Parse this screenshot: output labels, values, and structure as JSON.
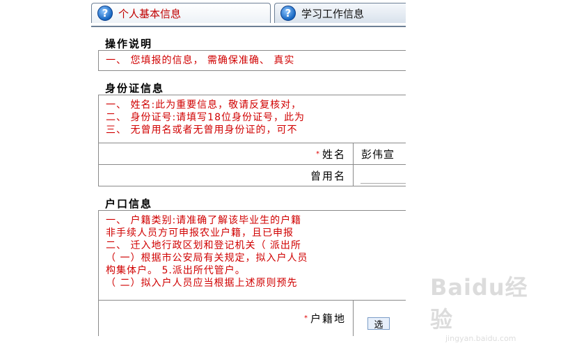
{
  "tabs": [
    {
      "label": "个人基本信息",
      "state": "active"
    },
    {
      "label": "学习工作信息",
      "state": "inactive"
    }
  ],
  "operation": {
    "title": "操作说明",
    "lines": [
      "一、 您填报的信息， 需确保准确、 真实"
    ]
  },
  "identity": {
    "title": "身份证信息",
    "lines": [
      "一、 姓名:此为重要信息，敬请反复核对，",
      "二、 身份证号:请填写18位身份证号，此为",
      "三、 无曾用名或者无曾用身份证的，可不"
    ],
    "required_mark": "*",
    "name_label": "姓名",
    "name_value": "彭伟宣",
    "former_name_label": "曾用名",
    "former_name_value": ""
  },
  "household": {
    "title": "户口信息",
    "lines": [
      "一、 户籍类别:请准确了解该毕业生的户籍",
      "非手续人员方可申报农业户籍，且已申报",
      "二、 迁入地行政区划和登记机关（ 派出所",
      "（ 一）根据市公安局有关规定，拟入户人员",
      "构集体户。 5.派出所代管户。",
      "（ 二）拟入户人员应当根据上述原则预先"
    ],
    "required_mark": "*",
    "reg_label": "户籍地",
    "select_button": "选"
  },
  "watermark": {
    "main": "Baidu经验",
    "sub": "jingyan.baidu.com"
  },
  "colors": {
    "accent_red": "#d00000",
    "border": "#8a8a8a"
  }
}
